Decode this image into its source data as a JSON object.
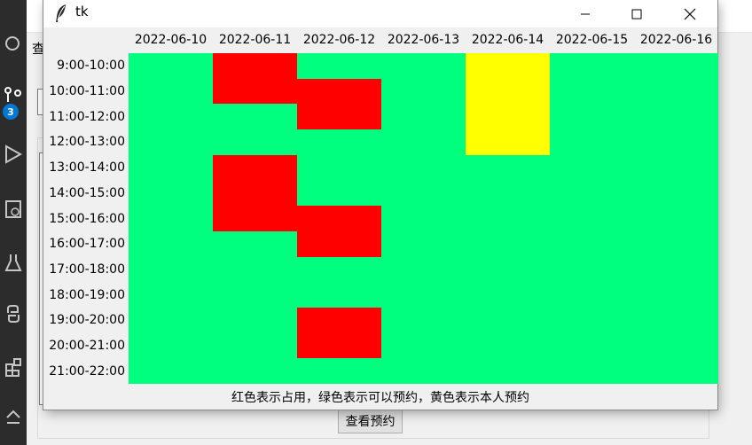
{
  "activity_bar": {
    "badge_count": "3",
    "icons": [
      "search-icon",
      "source-control-icon",
      "run-debug-icon",
      "remote-explorer-icon",
      "testing-icon",
      "python-icon",
      "extensions-icon",
      "account-icon"
    ]
  },
  "background_window": {
    "menu_item": "查",
    "view_booking_button": "查看预约"
  },
  "tk_window": {
    "title": "tk",
    "controls": [
      "minimize",
      "maximize",
      "close"
    ],
    "dates": [
      "2022-06-10",
      "2022-06-11",
      "2022-06-12",
      "2022-06-13",
      "2022-06-14",
      "2022-06-15",
      "2022-06-16"
    ],
    "time_slots": [
      "9:00-10:00",
      "10:00-11:00",
      "11:00-12:00",
      "12:00-13:00",
      "13:00-14:00",
      "14:00-15:00",
      "15:00-16:00",
      "16:00-17:00",
      "17:00-18:00",
      "18:00-19:00",
      "19:00-20:00",
      "20:00-21:00",
      "21:00-22:00"
    ],
    "colors": {
      "available": "#00ff7f",
      "occupied": "#ff0000",
      "mine": "#ffff00"
    },
    "occupied_slots": [
      {
        "date": "2022-06-11",
        "slots": [
          "9:00-10:00",
          "10:00-11:00",
          "13:00-14:00",
          "14:00-15:00",
          "15:00-16:00"
        ]
      },
      {
        "date": "2022-06-12",
        "slots": [
          "10:00-11:00",
          "11:00-12:00",
          "15:00-16:00",
          "16:00-17:00",
          "19:00-20:00",
          "20:00-21:00"
        ]
      }
    ],
    "mine_slots": [
      {
        "date": "2022-06-14",
        "slots": [
          "9:00-10:00",
          "10:00-11:00",
          "11:00-12:00",
          "12:00-13:00"
        ]
      }
    ],
    "legend": "红色表示占用，绿色表示可以预约，黄色表示本人预约"
  }
}
